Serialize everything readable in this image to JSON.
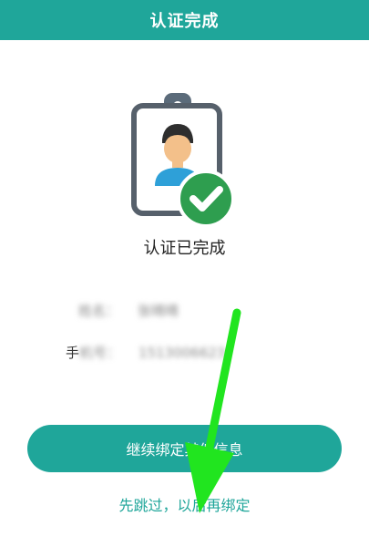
{
  "header": {
    "title": "认证完成"
  },
  "illustration": {
    "icon": "id-badge-check-icon"
  },
  "status": {
    "text": "认证已完成"
  },
  "info": {
    "name_label": "姓名：",
    "name_value": "张晴晴",
    "phone_label_visible": "手",
    "phone_label_blurred": "机号：",
    "phone_value": "1513006623"
  },
  "actions": {
    "primary_label": "继续绑定其他信息",
    "skip_label": "先跳过，以后再绑定"
  },
  "colors": {
    "accent": "#1fa69a",
    "check_green": "#2e9e4f",
    "arrow_green": "#21e51f"
  }
}
